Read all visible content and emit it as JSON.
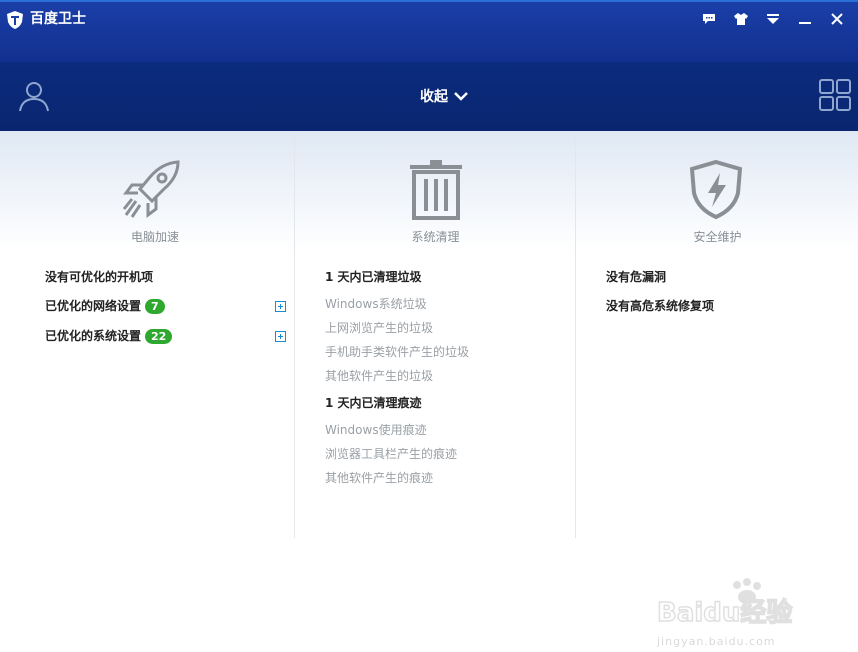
{
  "app": {
    "title": "百度卫士"
  },
  "navbar": {
    "collapse_label": "收起"
  },
  "columns": [
    {
      "label": "电脑加速",
      "icon": "rocket-icon",
      "items": [
        {
          "text": "没有可优化的开机项"
        },
        {
          "text": "已优化的网络设置",
          "badge": "7"
        },
        {
          "text": "已优化的系统设置",
          "badge": "22"
        }
      ]
    },
    {
      "label": "系统清理",
      "icon": "trash-icon",
      "section1": "1 天内已清理垃圾",
      "section1_items": [
        "Windows系统垃圾",
        "上网浏览产生的垃圾",
        "手机助手类软件产生的垃圾",
        "其他软件产生的垃圾"
      ],
      "section2": "1 天内已清理痕迹",
      "section2_items": [
        "Windows使用痕迹",
        "浏览器工具栏产生的痕迹",
        "其他软件产生的痕迹"
      ]
    },
    {
      "label": "安全维护",
      "icon": "shield-icon",
      "items": [
        {
          "text": "没有危漏洞"
        },
        {
          "text": "没有高危系统修复项"
        }
      ]
    }
  ],
  "watermark": {
    "brand": "Baidu经验",
    "url": "jingyan.baidu.com"
  },
  "colors": {
    "title_bar": "#1a3fa8",
    "nav_bar": "#0a2670",
    "badge": "#2ea82e"
  }
}
